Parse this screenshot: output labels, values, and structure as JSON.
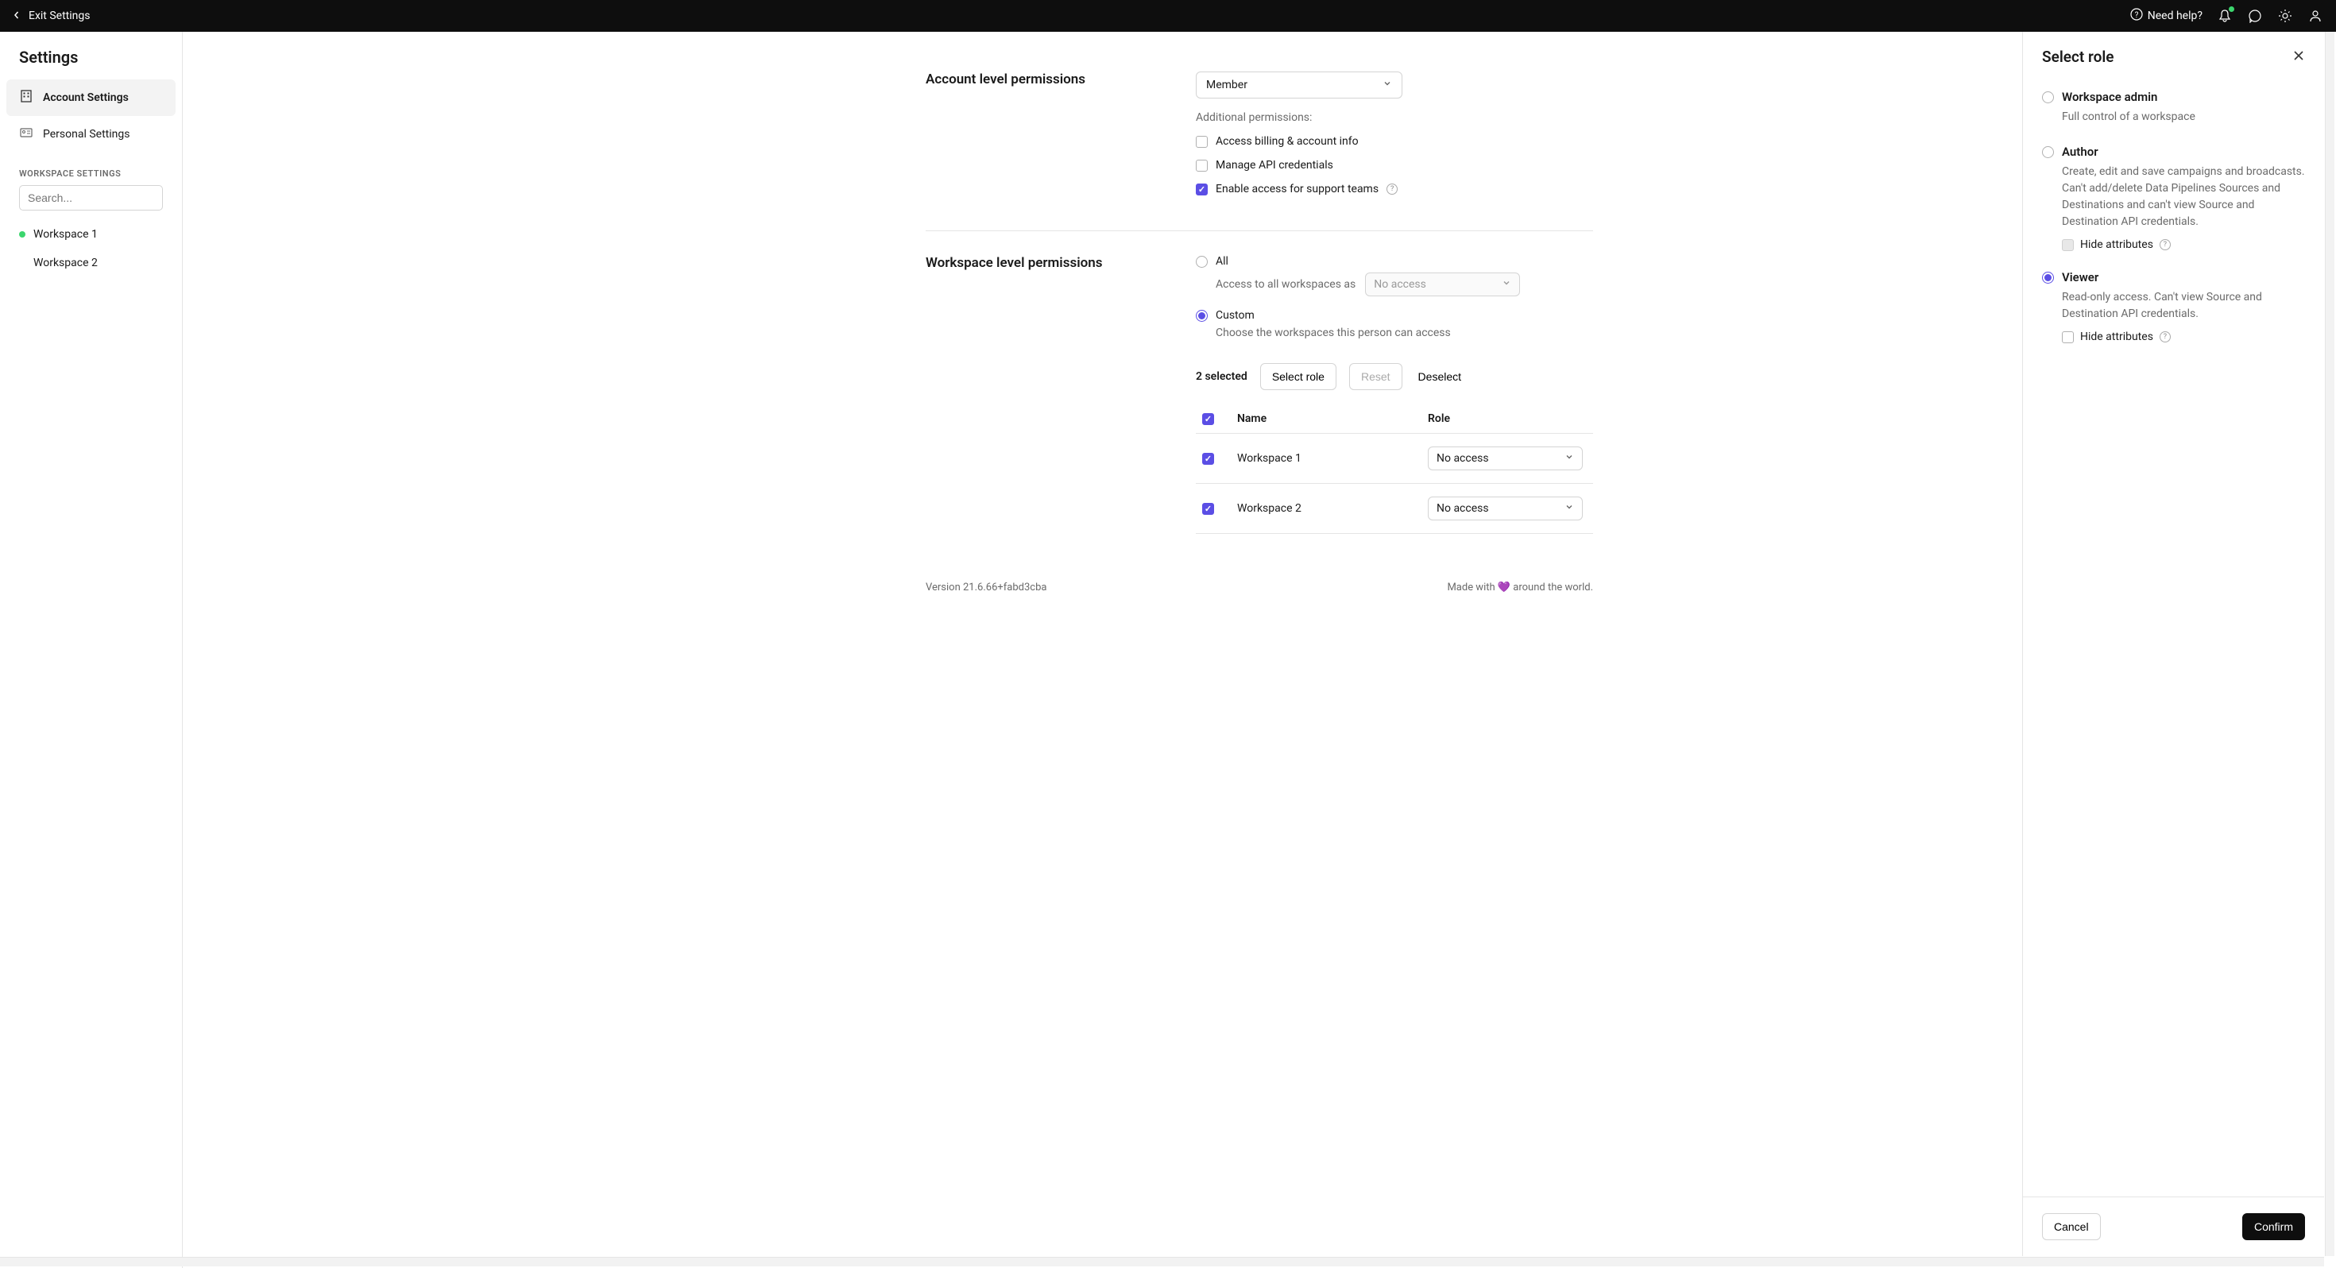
{
  "topbar": {
    "exit": "Exit Settings",
    "help": "Need help?"
  },
  "sidebar": {
    "title": "Settings",
    "nav": {
      "account": "Account Settings",
      "personal": "Personal Settings"
    },
    "workspace_heading": "WORKSPACE SETTINGS",
    "search_placeholder": "Search...",
    "workspaces": [
      "Workspace 1",
      "Workspace 2"
    ]
  },
  "account_section": {
    "title": "Account level permissions",
    "role_selected": "Member",
    "additional_label": "Additional permissions:",
    "perms": {
      "billing": "Access billing & account info",
      "api": "Manage API credentials",
      "support": "Enable access for support teams"
    }
  },
  "workspace_section": {
    "title": "Workspace level permissions",
    "all_label": "All",
    "all_sub": "Access to all workspaces as",
    "all_select": "No access",
    "custom_label": "Custom",
    "custom_sub": "Choose the workspaces this person can access"
  },
  "toolbar": {
    "selected": "2 selected",
    "select_role": "Select role",
    "reset": "Reset",
    "deselect": "Deselect"
  },
  "table": {
    "col_name": "Name",
    "col_role": "Role",
    "rows": [
      {
        "name": "Workspace 1",
        "role": "No access"
      },
      {
        "name": "Workspace 2",
        "role": "No access"
      }
    ]
  },
  "footer": {
    "version": "Version 21.6.66+fabd3cba",
    "made": "Made with 💜 around the world."
  },
  "panel": {
    "title": "Select role",
    "roles": {
      "admin": {
        "title": "Workspace admin",
        "desc": "Full control of a workspace"
      },
      "author": {
        "title": "Author",
        "desc": "Create, edit and save campaigns and broadcasts. Can't add/delete Data Pipelines Sources and Destinations and can't view Source and Destination API credentials.",
        "hide": "Hide attributes"
      },
      "viewer": {
        "title": "Viewer",
        "desc": "Read-only access. Can't view Source and Destination API credentials.",
        "hide": "Hide attributes"
      }
    },
    "cancel": "Cancel",
    "confirm": "Confirm"
  }
}
